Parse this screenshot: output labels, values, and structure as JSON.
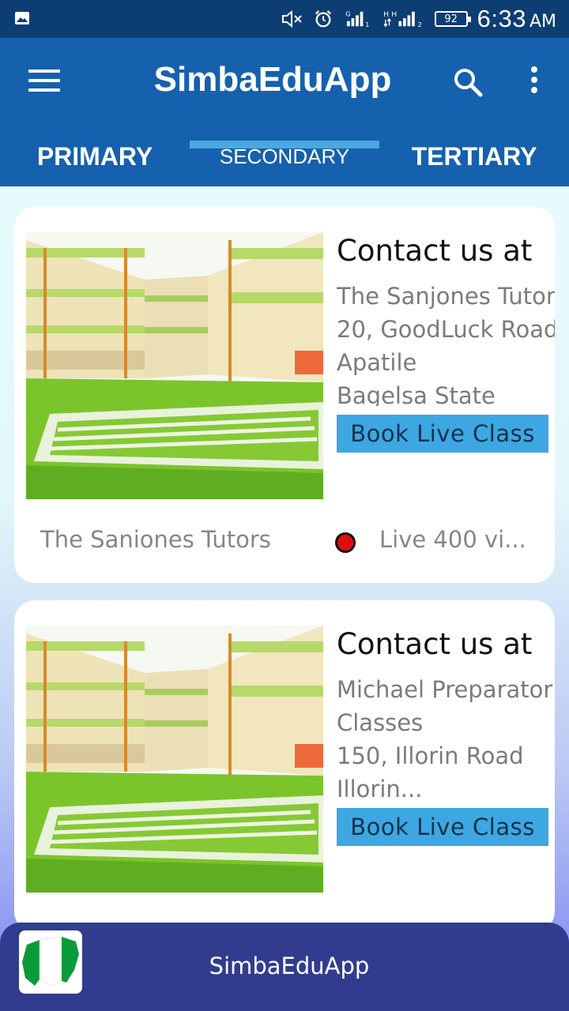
{
  "status_bar": {
    "battery": "92",
    "time": "6:33",
    "ampm": "AM",
    "icons": [
      "image-icon",
      "mute-icon",
      "alarm-icon",
      "signal-g-icon",
      "signal-h-icon",
      "battery-icon"
    ]
  },
  "app_bar": {
    "title": "SimbaEduApp",
    "icons": [
      "menu-icon",
      "search-icon",
      "more-vert-icon"
    ],
    "color": "#1561ae"
  },
  "tabs": [
    {
      "label": "PRIMARY"
    },
    {
      "label": "SECONDARY"
    },
    {
      "label": "TERTIARY"
    }
  ],
  "active_tab": "SECONDARY",
  "cards": [
    {
      "heading": "Contact us at",
      "address": [
        "The Sanjones Tutor",
        "20, GoodLuck Road",
        "Apatile",
        "Bagelsa State"
      ],
      "button": "Book Live Class",
      "name": "The Saniones Tutors",
      "live": "Live  400 vi..."
    },
    {
      "heading": "Contact us at",
      "address": [
        "Michael Preparator",
        "Classes",
        "150, Illorin Road",
        "Illorin..."
      ],
      "button": "Book Live Class"
    }
  ],
  "bottom_bar": {
    "title": "SimbaEduApp",
    "icon": "nigeria-map-icon"
  }
}
